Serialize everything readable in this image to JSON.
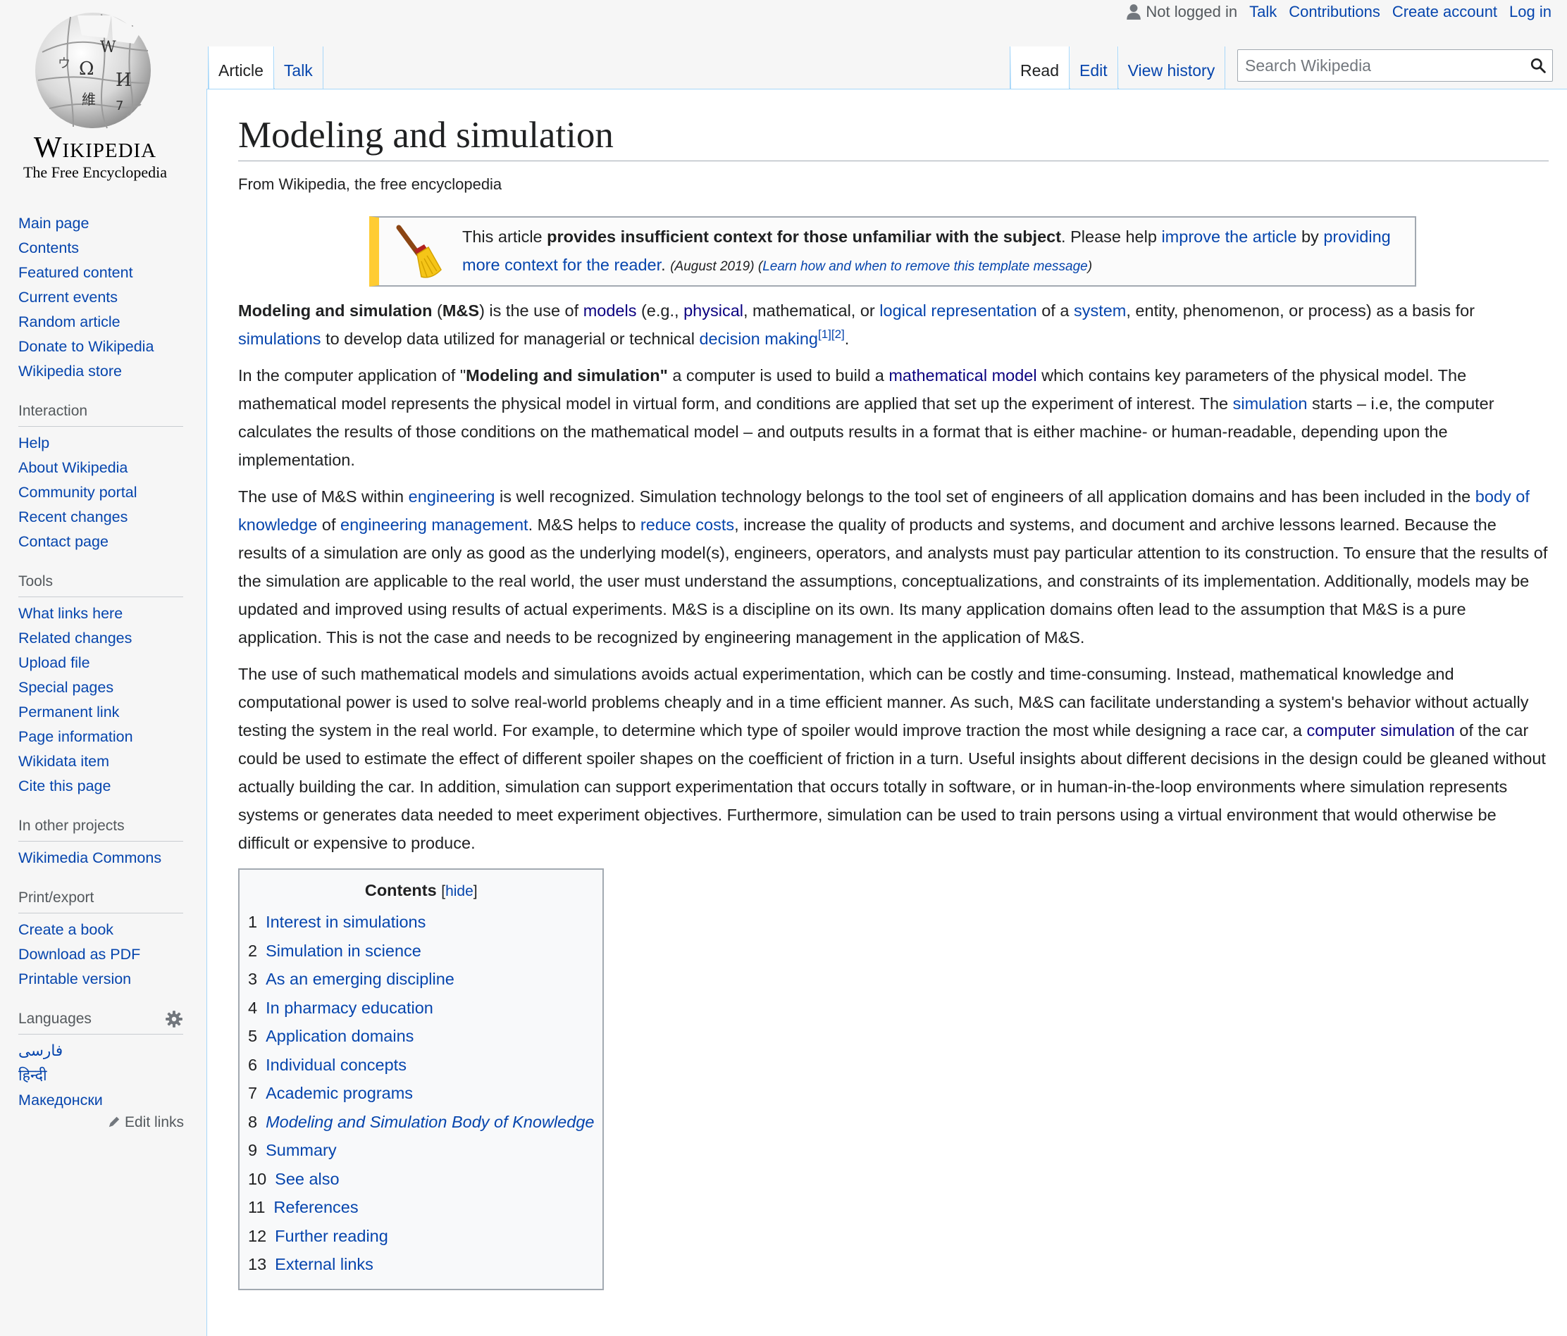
{
  "personal": {
    "not_logged_in": "Not logged in",
    "talk": "Talk",
    "contributions": "Contributions",
    "create_account": "Create account",
    "log_in": "Log in"
  },
  "logo": {
    "wordmark": "Wikipedia",
    "tagline": "The Free Encyclopedia"
  },
  "sidebar": {
    "navigation": [
      "Main page",
      "Contents",
      "Featured content",
      "Current events",
      "Random article",
      "Donate to Wikipedia",
      "Wikipedia store"
    ],
    "interaction": {
      "heading": "Interaction",
      "items": [
        "Help",
        "About Wikipedia",
        "Community portal",
        "Recent changes",
        "Contact page"
      ]
    },
    "tools": {
      "heading": "Tools",
      "items": [
        "What links here",
        "Related changes",
        "Upload file",
        "Special pages",
        "Permanent link",
        "Page information",
        "Wikidata item",
        "Cite this page"
      ]
    },
    "other_projects": {
      "heading": "In other projects",
      "items": [
        "Wikimedia Commons"
      ]
    },
    "print_export": {
      "heading": "Print/export",
      "items": [
        "Create a book",
        "Download as PDF",
        "Printable version"
      ]
    },
    "languages": {
      "heading": "Languages",
      "items": [
        "فارسی",
        "हिन्दी",
        "Македонски"
      ],
      "edit_links": "Edit links"
    }
  },
  "tabs": {
    "left": [
      "Article",
      "Talk"
    ],
    "right": [
      "Read",
      "Edit",
      "View history"
    ]
  },
  "search": {
    "placeholder": "Search Wikipedia"
  },
  "article": {
    "title": "Modeling and simulation",
    "site_sub": "From Wikipedia, the free encyclopedia",
    "ambox": {
      "t1": "This article ",
      "bold": "provides insufficient context for those unfamiliar with the subject",
      "t2": ". Please help ",
      "link1": "improve the article",
      "t3": " by ",
      "link2": "providing more context for the reader",
      "t4": ". ",
      "date": "(August 2019)",
      "t5": " (",
      "link3": "Learn how and when to remove this template message",
      "t6": ")"
    },
    "p1": {
      "b1": "Modeling and simulation",
      "t1": " (",
      "b2": "M&S",
      "t2": ") is the use of ",
      "l1": "models",
      "t3": " (e.g., ",
      "l2": "physical",
      "t4": ", mathematical, or ",
      "l3": "logical representation",
      "t5": " of a ",
      "l4": "system",
      "t6": ", entity, phenomenon, or process) as a basis for ",
      "l5": "simulations",
      "t7": " to develop data utilized for managerial or technical ",
      "l6": "decision making",
      "ref1": "[1]",
      "ref2": "[2]",
      "t8": "."
    },
    "p2": {
      "t1": "In the computer application of \"",
      "b1": "Modeling and simulation\"",
      "t2": " a computer is used to build a ",
      "l1": "mathematical model",
      "t3": " which contains key parameters of the physical model. The mathematical model represents the physical model in virtual form, and conditions are applied that set up the experiment of interest. The ",
      "l2": "simulation",
      "t4": " starts – i.e, the computer calculates the results of those conditions on the mathematical model – and outputs results in a format that is either machine- or human-readable, depending upon the implementation."
    },
    "p3": {
      "t1": "The use of M&S within ",
      "l1": "engineering",
      "t2": " is well recognized. Simulation technology belongs to the tool set of engineers of all application domains and has been included in the ",
      "l2": "body of knowledge",
      "t3": " of ",
      "l3": "engineering management",
      "t4": ". M&S helps to ",
      "l4": "reduce costs",
      "t5": ", increase the quality of products and systems, and document and archive lessons learned. Because the results of a simulation are only as good as the underlying model(s), engineers, operators, and analysts must pay particular attention to its construction. To ensure that the results of the simulation are applicable to the real world, the user must understand the assumptions, conceptualizations, and constraints of its implementation. Additionally, models may be updated and improved using results of actual experiments. M&S is a discipline on its own. Its many application domains often lead to the assumption that M&S is a pure application. This is not the case and needs to be recognized by engineering management in the application of M&S."
    },
    "p4": {
      "t1": "The use of such mathematical models and simulations avoids actual experimentation, which can be costly and time-consuming. Instead, mathematical knowledge and computational power is used to solve real-world problems cheaply and in a time efficient manner. As such, M&S can facilitate understanding a system's behavior without actually testing the system in the real world. For example, to determine which type of spoiler would improve traction the most while designing a race car, a ",
      "l1": "computer simulation",
      "t2": " of the car could be used to estimate the effect of different spoiler shapes on the coefficient of friction in a turn. Useful insights about different decisions in the design could be gleaned without actually building the car. In addition, simulation can support experimentation that occurs totally in software, or in human-in-the-loop environments where simulation represents systems or generates data needed to meet experiment objectives. Furthermore, simulation can be used to train persons using a virtual environment that would otherwise be difficult or expensive to produce."
    },
    "toc": {
      "title": "Contents",
      "hide": "hide",
      "items": [
        {
          "num": "1",
          "text": "Interest in simulations"
        },
        {
          "num": "2",
          "text": "Simulation in science"
        },
        {
          "num": "3",
          "text": "As an emerging discipline"
        },
        {
          "num": "4",
          "text": "In pharmacy education"
        },
        {
          "num": "5",
          "text": "Application domains"
        },
        {
          "num": "6",
          "text": "Individual concepts"
        },
        {
          "num": "7",
          "text": "Academic programs"
        },
        {
          "num": "8",
          "text": "Modeling and Simulation Body of Knowledge"
        },
        {
          "num": "9",
          "text": "Summary"
        },
        {
          "num": "10",
          "text": "See also"
        },
        {
          "num": "11",
          "text": "References"
        },
        {
          "num": "12",
          "text": "Further reading"
        },
        {
          "num": "13",
          "text": "External links"
        }
      ]
    }
  }
}
